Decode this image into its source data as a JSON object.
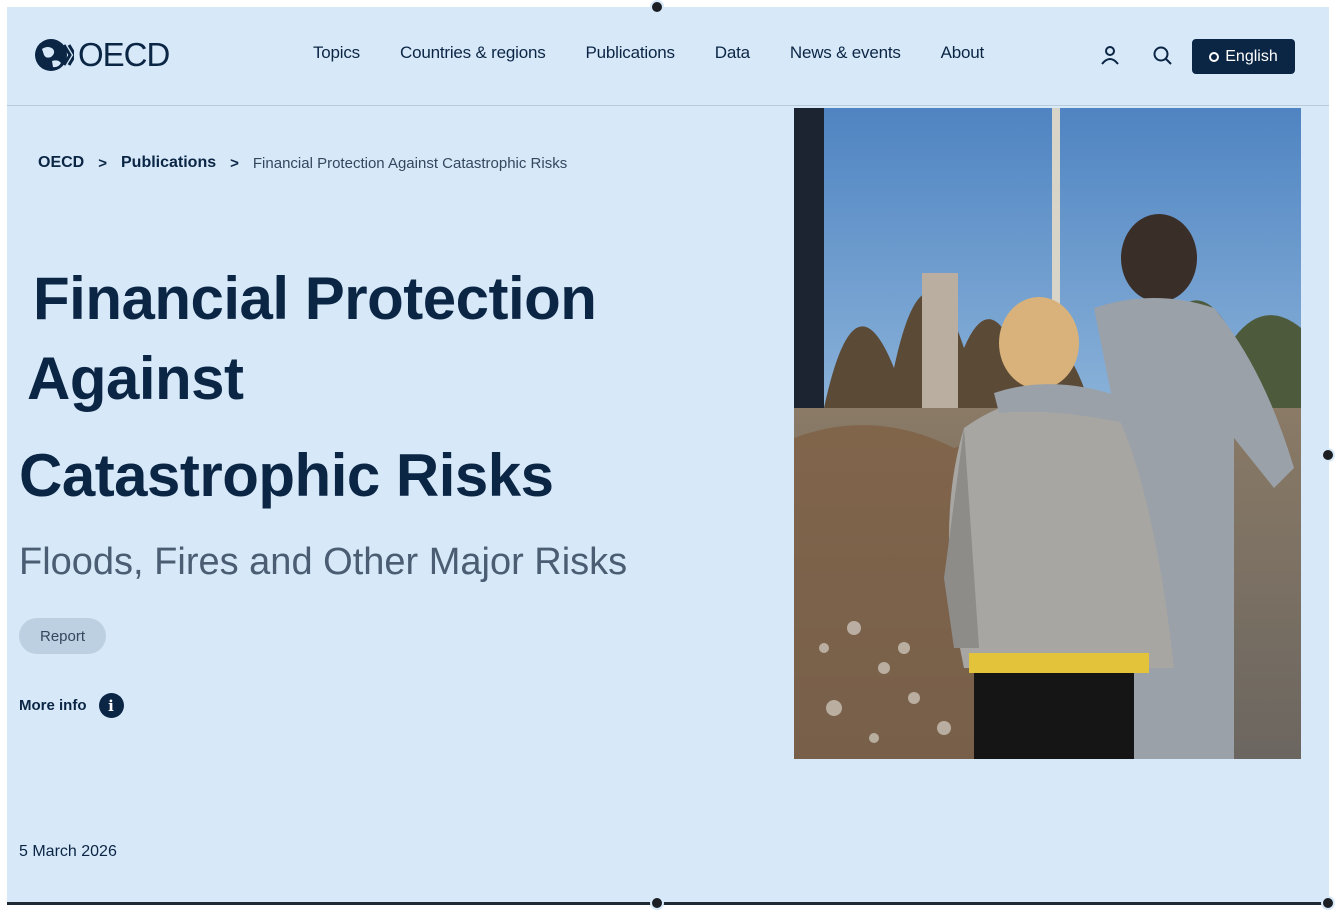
{
  "brand": {
    "logo_text": "OECD"
  },
  "nav": {
    "items": [
      {
        "label": "Topics"
      },
      {
        "label": "Countries & regions"
      },
      {
        "label": "Publications"
      },
      {
        "label": "Data"
      },
      {
        "label": "News & events"
      },
      {
        "label": "About"
      }
    ],
    "icons": [
      "user-icon",
      "search-icon"
    ],
    "language_label": "English"
  },
  "breadcrumb": {
    "items": [
      {
        "label": "OECD"
      },
      {
        "label": "Publications"
      },
      {
        "label": "Financial Protection Against Catastrophic Risks"
      }
    ],
    "separator": ">"
  },
  "publication": {
    "title_lines": [
      "Financial Protection",
      "Against",
      "Catastrophic Risks"
    ],
    "subtitle": "Floods, Fires and Other Major Risks",
    "type_tag": "Report",
    "more_info_label": "More info",
    "date": "5 March 2026"
  },
  "colors": {
    "background": "#d7e9f8",
    "primary": "#0b2545",
    "subtitle": "#4a5d72",
    "tag_bg": "#bcd0e2"
  }
}
